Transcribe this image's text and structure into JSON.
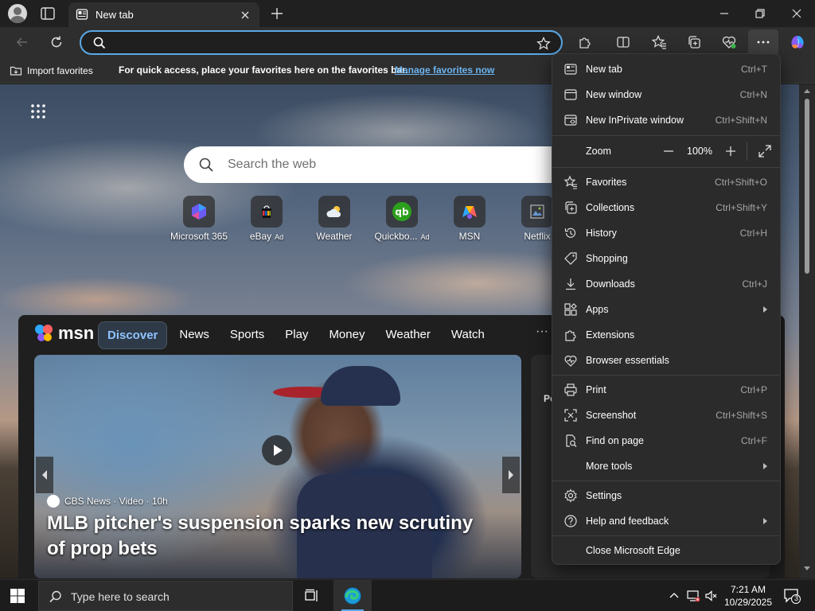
{
  "browser": {
    "tab_title": "New tab",
    "address_value": "",
    "favorites_bar": {
      "import_label": "Import favorites",
      "message": "For quick access, place your favorites here on the favorites bar.",
      "manage_link": "Manage favorites now"
    }
  },
  "newtab": {
    "search_placeholder": "Search the web",
    "tiles": [
      {
        "label": "Microsoft 365",
        "ad": "",
        "icon": "microsoft-365-icon"
      },
      {
        "label": "eBay",
        "ad": "Ad",
        "icon": "ebay-icon"
      },
      {
        "label": "Weather",
        "ad": "",
        "icon": "weather-icon"
      },
      {
        "label": "Quickbo...",
        "ad": "Ad",
        "icon": "quickbooks-icon"
      },
      {
        "label": "MSN",
        "ad": "",
        "icon": "msn-icon"
      },
      {
        "label": "Netflix",
        "ad": "",
        "icon": "netflix-icon"
      }
    ]
  },
  "msn": {
    "logo": "msn",
    "nav": [
      "Discover",
      "News",
      "Sports",
      "Play",
      "Money",
      "Weather",
      "Watch"
    ],
    "active_nav": "Discover",
    "hero": {
      "source": "CBS News · Video · 10h",
      "headline": "MLB pitcher's suspension sparks new scrutiny of prop bets"
    },
    "side_card_heading": "Po"
  },
  "menu": {
    "items": [
      {
        "label": "New tab",
        "shortcut": "Ctrl+T",
        "icon": "new-tab-icon"
      },
      {
        "label": "New window",
        "shortcut": "Ctrl+N",
        "icon": "new-window-icon"
      },
      {
        "label": "New InPrivate window",
        "shortcut": "Ctrl+Shift+N",
        "icon": "inprivate-icon"
      },
      {
        "label": "Zoom",
        "shortcut": "",
        "icon": ""
      },
      {
        "label": "Favorites",
        "shortcut": "Ctrl+Shift+O",
        "icon": "favorites-icon"
      },
      {
        "label": "Collections",
        "shortcut": "Ctrl+Shift+Y",
        "icon": "collections-icon"
      },
      {
        "label": "History",
        "shortcut": "Ctrl+H",
        "icon": "history-icon"
      },
      {
        "label": "Shopping",
        "shortcut": "",
        "icon": "shopping-icon"
      },
      {
        "label": "Downloads",
        "shortcut": "Ctrl+J",
        "icon": "downloads-icon"
      },
      {
        "label": "Apps",
        "shortcut": "",
        "icon": "apps-icon"
      },
      {
        "label": "Extensions",
        "shortcut": "",
        "icon": "extensions-icon"
      },
      {
        "label": "Browser essentials",
        "shortcut": "",
        "icon": "browser-essentials-icon"
      },
      {
        "label": "Print",
        "shortcut": "Ctrl+P",
        "icon": "print-icon"
      },
      {
        "label": "Screenshot",
        "shortcut": "Ctrl+Shift+S",
        "icon": "screenshot-icon"
      },
      {
        "label": "Find on page",
        "shortcut": "Ctrl+F",
        "icon": "find-icon"
      },
      {
        "label": "More tools",
        "shortcut": "",
        "icon": ""
      },
      {
        "label": "Settings",
        "shortcut": "",
        "icon": "settings-icon"
      },
      {
        "label": "Help and feedback",
        "shortcut": "",
        "icon": "help-icon"
      },
      {
        "label": "Close Microsoft Edge",
        "shortcut": "",
        "icon": ""
      }
    ],
    "zoom_value": "100%"
  },
  "taskbar": {
    "search_placeholder": "Type here to search",
    "time": "7:21 AM",
    "date": "10/29/2025",
    "notification_count": "3"
  },
  "colors": {
    "accent": "#5aa8e6",
    "link": "#6cb4f0",
    "menu_bg": "#2b2b2b"
  }
}
